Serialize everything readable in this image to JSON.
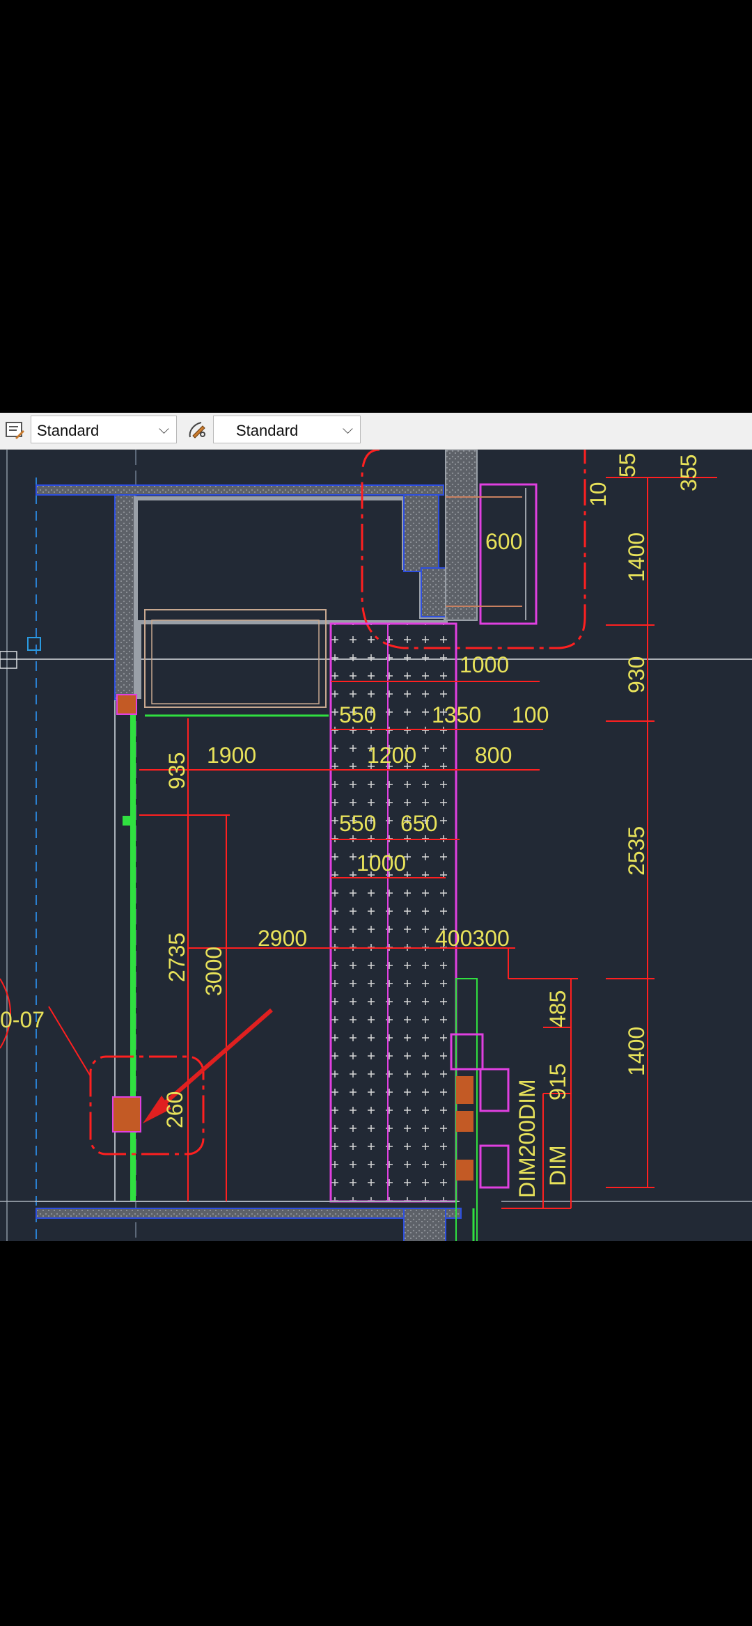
{
  "toolbar": {
    "text_style_select": {
      "value": "Standard",
      "icon": "text-style-icon"
    },
    "dim_style_select": {
      "value": "Standard",
      "icon": "dim-style-icon"
    }
  },
  "drawing": {
    "dimensions": {
      "d_55": "55",
      "d_10": "10",
      "d_355": "355",
      "d_600": "600",
      "d_1400_top": "1400",
      "d_1000_top": "1000",
      "d_930": "930",
      "d_550_a": "550",
      "d_1350": "1350",
      "d_100": "100",
      "d_935": "935",
      "d_1900": "1900",
      "d_1200": "1200",
      "d_800": "800",
      "d_550_b": "550",
      "d_650": "650",
      "d_1000_mid": "1000",
      "d_2535": "2535",
      "d_2735": "2735",
      "d_3000": "3000",
      "d_2900": "2900",
      "d_400300": "400300",
      "d_485": "485",
      "d_1400_bottom": "1400",
      "d_915": "915",
      "d_dim200dim": "DIM200DIM",
      "d_dim": "DIM",
      "d_260": "260",
      "label_07": "0-07"
    },
    "colors": {
      "background": "#222935",
      "dimension": "#e8e25a",
      "dimension_lines": "#ff2020",
      "wall_outline": "#9aa0a8",
      "magenta": "#e040e0",
      "green": "#30e040",
      "blue_dash": "#2a7fd0"
    }
  }
}
